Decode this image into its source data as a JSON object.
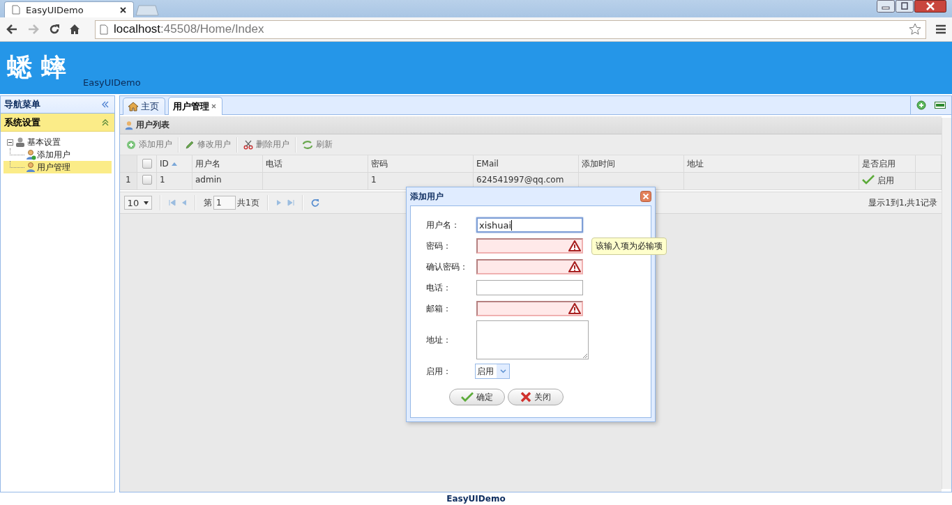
{
  "browser": {
    "tab_title": "EasyUIDemo",
    "url_host": "localhost",
    "url_path": ":45508/Home/Index"
  },
  "header": {
    "logo": "蟋 蟀",
    "subtitle": "EasyUIDemo"
  },
  "sidebar": {
    "title": "导航菜单",
    "sections": [
      {
        "title": "系统设置",
        "expanded": true,
        "tree": [
          {
            "label": "基本设置",
            "kind": "group",
            "expanded": true,
            "selected": false,
            "children": [
              {
                "label": "添加用户",
                "kind": "add-user",
                "selected": false
              },
              {
                "label": "用户管理",
                "kind": "user",
                "selected": true
              }
            ]
          }
        ]
      }
    ]
  },
  "tabs": [
    {
      "label": "主页",
      "kind": "home",
      "selected": false,
      "closable": false
    },
    {
      "label": "用户管理",
      "kind": "plain",
      "selected": true,
      "closable": true
    }
  ],
  "panel": {
    "title": "用户列表",
    "toolbar": [
      {
        "label": "添加用户",
        "kind": "add"
      },
      {
        "label": "修改用户",
        "kind": "edit"
      },
      {
        "label": "删除用户",
        "kind": "delete"
      },
      {
        "label": "刷新",
        "kind": "reload"
      }
    ],
    "grid": {
      "all_checked": false,
      "columns": [
        {
          "label": "ID",
          "sorted": true
        },
        {
          "label": "用户名",
          "sorted": false
        },
        {
          "label": "电话",
          "sorted": false
        },
        {
          "label": "密码",
          "sorted": false
        },
        {
          "label": "EMail",
          "sorted": false
        },
        {
          "label": "添加时间",
          "sorted": false
        },
        {
          "label": "地址",
          "sorted": false
        },
        {
          "label": "是否启用",
          "sorted": false
        }
      ],
      "rows": [
        {
          "number": "1",
          "checked": false,
          "id": "1",
          "username": "admin",
          "password": "1",
          "email": "624541997@qq.com",
          "enabled": true,
          "enabled_label": "启用"
        }
      ]
    },
    "pager": {
      "page_size": "10",
      "page_prefix": "第",
      "page": "1",
      "page_suffix": "共1页",
      "summary": "显示1到1,共1记录"
    }
  },
  "dialog": {
    "title": "添加用户",
    "fields": [
      {
        "label": "用户名：",
        "kind": "text",
        "value": "xishuai",
        "invalid": false,
        "focused": true
      },
      {
        "label": "密码：",
        "kind": "text",
        "invalid": true,
        "focused": false,
        "tooltip": "该输入项为必输项"
      },
      {
        "label": "确认密码：",
        "kind": "text",
        "invalid": true,
        "focused": false
      },
      {
        "label": "电话：",
        "kind": "text",
        "invalid": false,
        "focused": false
      },
      {
        "label": "邮箱：",
        "kind": "text",
        "invalid": true,
        "focused": false
      },
      {
        "label": "地址：",
        "kind": "textarea",
        "invalid": false
      },
      {
        "label": "启用：",
        "kind": "select",
        "value": "启用",
        "invalid": false
      }
    ],
    "buttons": [
      {
        "label": "确定",
        "kind": "ok"
      },
      {
        "label": "关闭",
        "kind": "cancel"
      }
    ]
  },
  "footer": "EasyUIDemo"
}
